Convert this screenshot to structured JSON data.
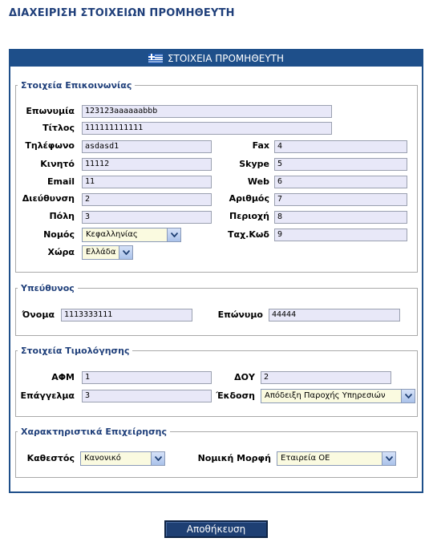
{
  "page_title": "ΔΙΑΧΕΙΡΙΣΗ ΣΤΟΙΧΕΙΩΝ ΠΡΟΜΗΘΕΥΤΗ",
  "panel_title": "ΣΤΟΙΧΕΙΑ ΠΡΟΜΗΘΕΥΤΗ",
  "contact": {
    "legend": "Στοιχεία Επικοινωνίας",
    "eponymia_label": "Επωνυμία",
    "eponymia_value": "123123aaaaaabbb",
    "titlos_label": "Τίτλος",
    "titlos_value": "111111111111",
    "tilefono_label": "Τηλέφωνο",
    "tilefono_value": "asdasd1",
    "fax_label": "Fax",
    "fax_value": "4",
    "kinito_label": "Κινητό",
    "kinito_value": "11112",
    "skype_label": "Skype",
    "skype_value": "5",
    "email_label": "Email",
    "email_value": "11",
    "web_label": "Web",
    "web_value": "6",
    "dieuthinsi_label": "Διεύθυνση",
    "dieuthinsi_value": "2",
    "arithmos_label": "Αριθμός",
    "arithmos_value": "7",
    "poli_label": "Πόλη",
    "poli_value": "3",
    "periochi_label": "Περιοχή",
    "periochi_value": "8",
    "nomos_label": "Νομός",
    "nomos_value": "Κεφαλληνίας",
    "tk_label": "Ταχ.Κωδ",
    "tk_value": "9",
    "chora_label": "Χώρα",
    "chora_value": "Ελλάδα"
  },
  "responsible": {
    "legend": "Υπεύθυνος",
    "onoma_label": "Όνομα",
    "onoma_value": "1113333111",
    "eponymo_label": "Επώνυμο",
    "eponymo_value": "44444"
  },
  "billing": {
    "legend": "Στοιχεία Τιμολόγησης",
    "afm_label": "ΑΦΜ",
    "afm_value": "1",
    "doy_label": "ΔΟΥ",
    "doy_value": "2",
    "epaggelma_label": "Επάγγελμα",
    "epaggelma_value": "3",
    "ekdosi_label": "Έκδοση",
    "ekdosi_value": "Απόδειξη Παροχής Υπηρεσιών"
  },
  "business": {
    "legend": "Χαρακτηριστικά Επιχείρησης",
    "kathestos_label": "Καθεστός",
    "kathestos_value": "Κανονικό",
    "nomiki_label": "Νομική Μορφή",
    "nomiki_value": "Εταιρεία ΟΕ"
  },
  "save_label": "Αποθήκευση",
  "colors": {
    "accent": "#1e4f8a",
    "legend": "#1f3f7a",
    "input_bg": "#e8e8f8",
    "select_bg": "#fafae0"
  },
  "icons": {
    "flag": "greek-flag-icon",
    "dropdown": "chevron-down-icon"
  }
}
